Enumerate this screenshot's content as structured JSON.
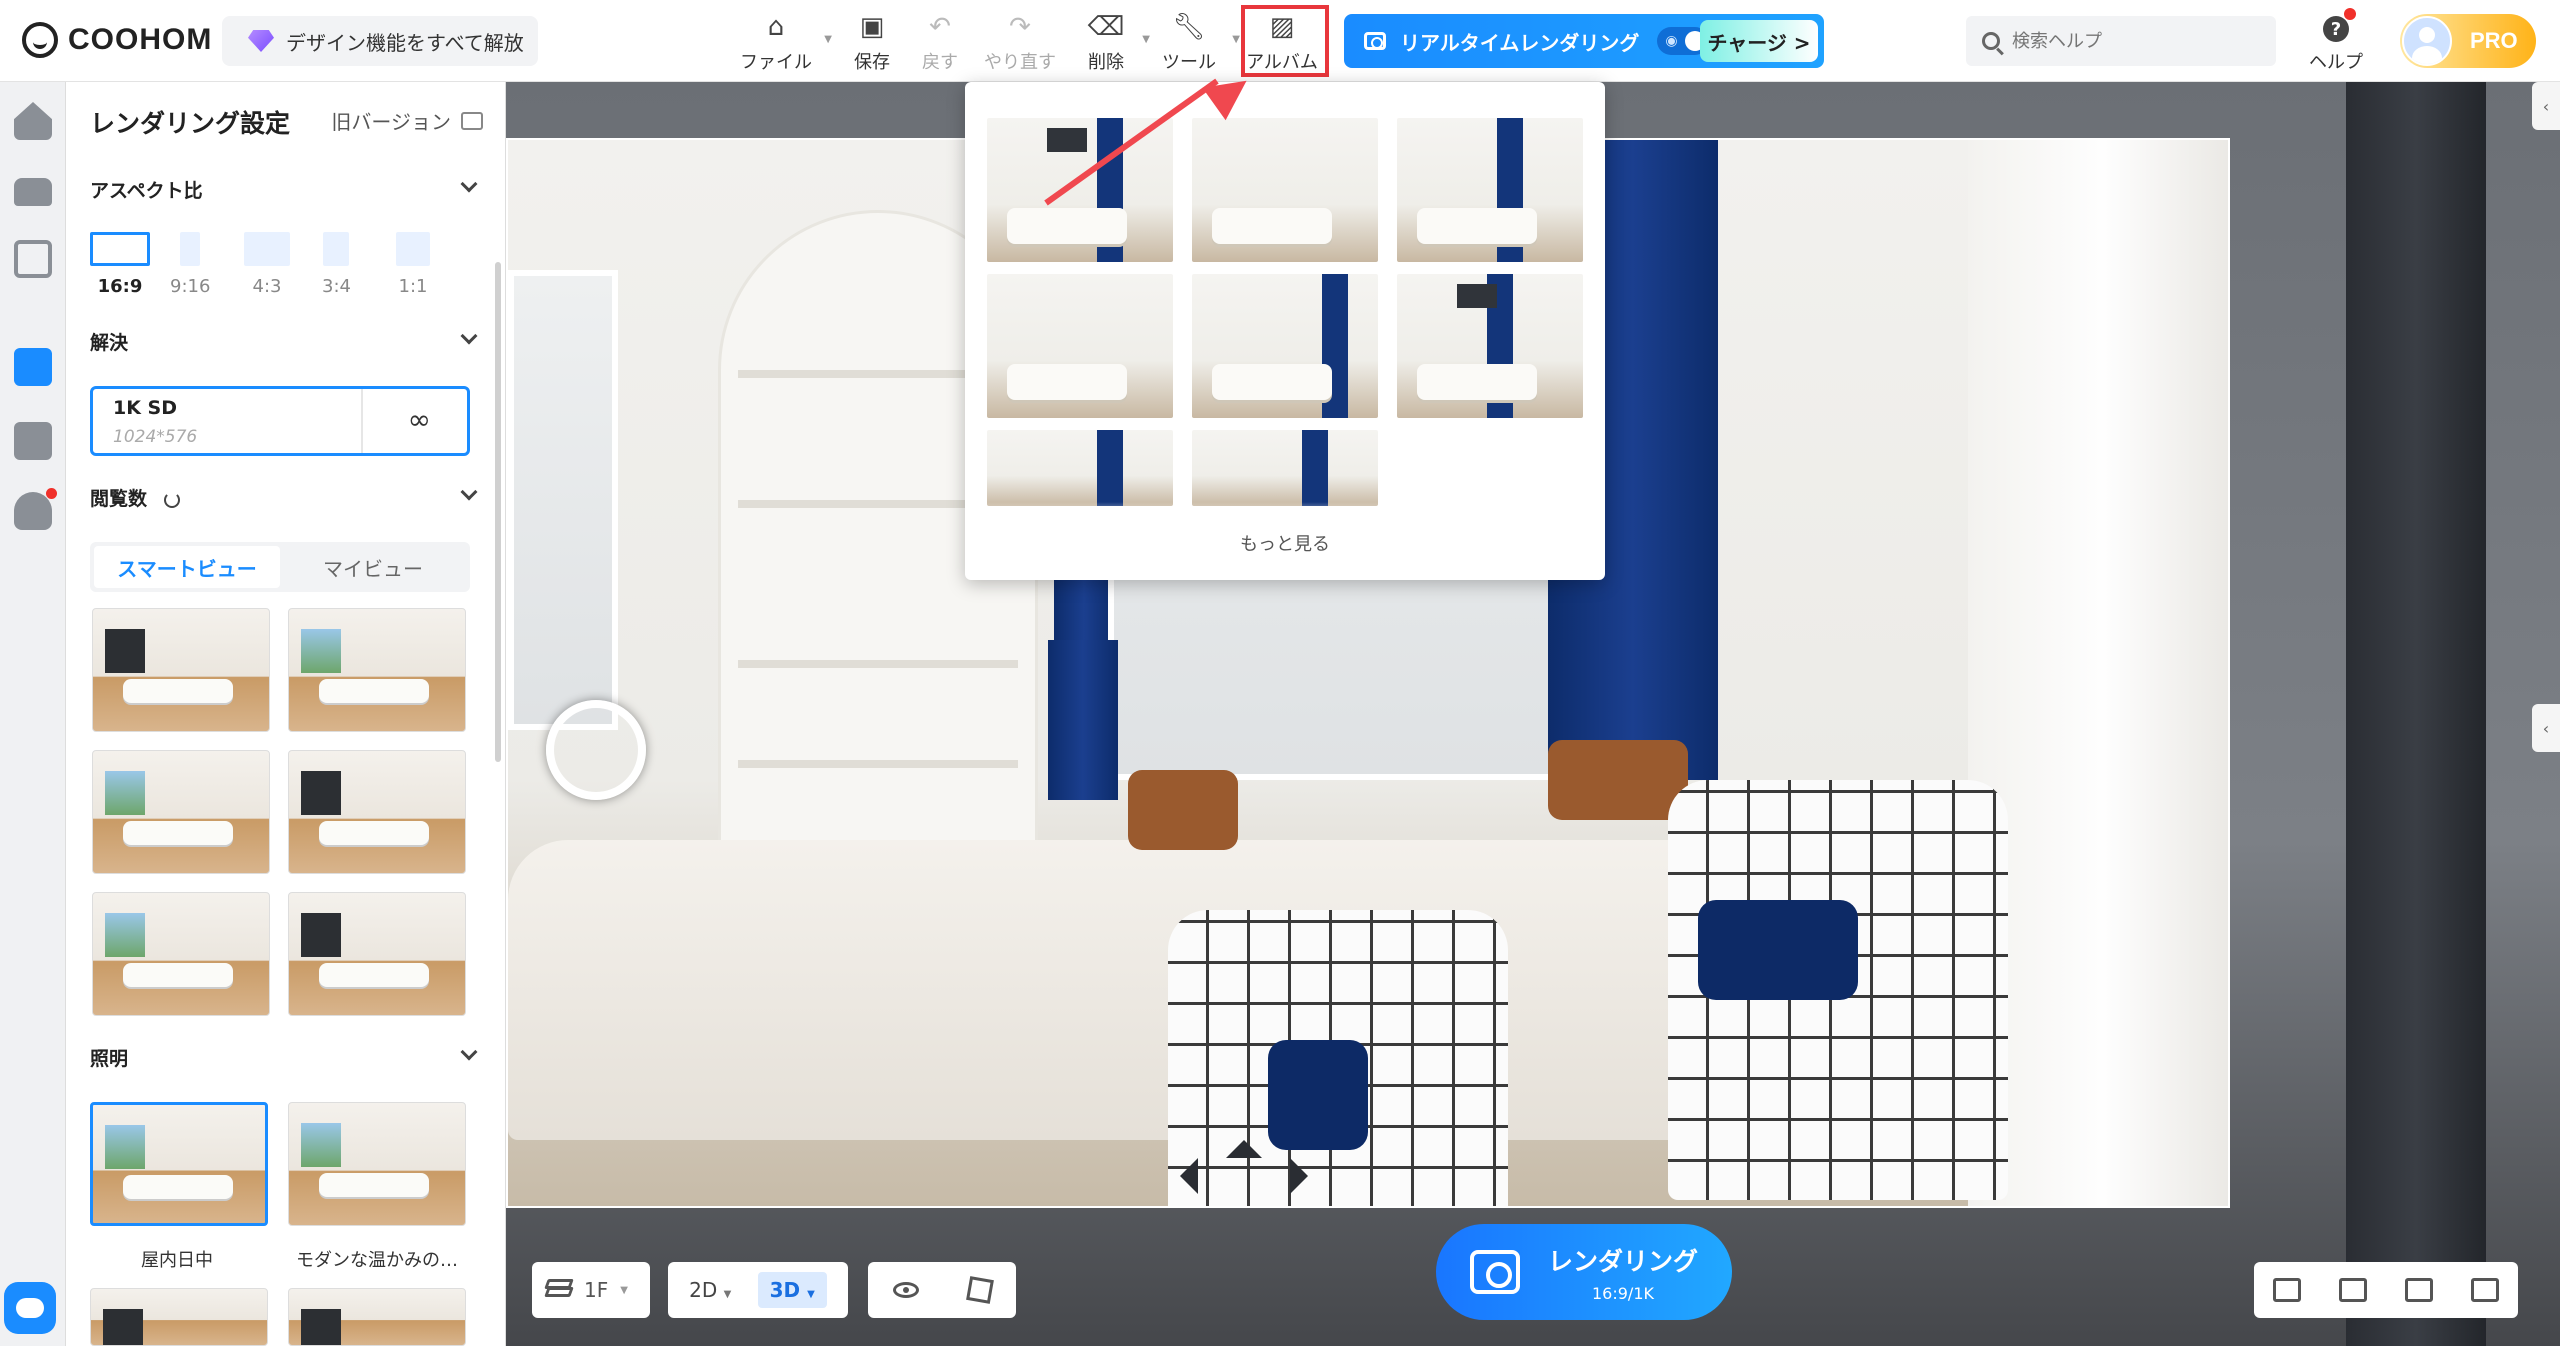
{
  "app": {
    "logo_text": "COOHOM",
    "unlock_label": "デザイン機能をすべて解放"
  },
  "toolbar": {
    "file": "ファイル",
    "save": "保存",
    "undo": "戻す",
    "redo": "やり直す",
    "delete": "削除",
    "tools": "ツール",
    "album": "アルバム"
  },
  "realtime": {
    "label": "リアルタイムレンダリング",
    "charge": "チャージ >"
  },
  "search": {
    "placeholder": "検索ヘルプ"
  },
  "help": {
    "label": "ヘルプ"
  },
  "account": {
    "badge": "PRO"
  },
  "panel": {
    "title": "レンダリング設定",
    "old_version": "旧バージョン",
    "aspect": {
      "heading": "アスペクト比",
      "options": [
        "16:9",
        "9:16",
        "4:3",
        "3:4",
        "1:1"
      ],
      "selected": "16:9"
    },
    "resolution": {
      "heading": "解決",
      "value": "1K SD",
      "detail": "1024*576",
      "icon": "infinity-icon"
    },
    "views": {
      "heading": "閲覧数",
      "tabs": [
        "スマートビュー",
        "マイビュー"
      ],
      "active_tab": "スマートビュー"
    },
    "lighting": {
      "heading": "照明",
      "items": [
        "屋内日中",
        "モダンな温かみの…"
      ]
    }
  },
  "album_dropdown": {
    "more": "もっと見る"
  },
  "bottom": {
    "floor": "1F",
    "view_2d": "2D",
    "view_3d": "3D",
    "render_label": "レンダリング",
    "render_sub": "16:9/1K"
  },
  "colors": {
    "accent": "#1a8cff",
    "highlight": "#e8363c",
    "pro": "#ffb318"
  }
}
